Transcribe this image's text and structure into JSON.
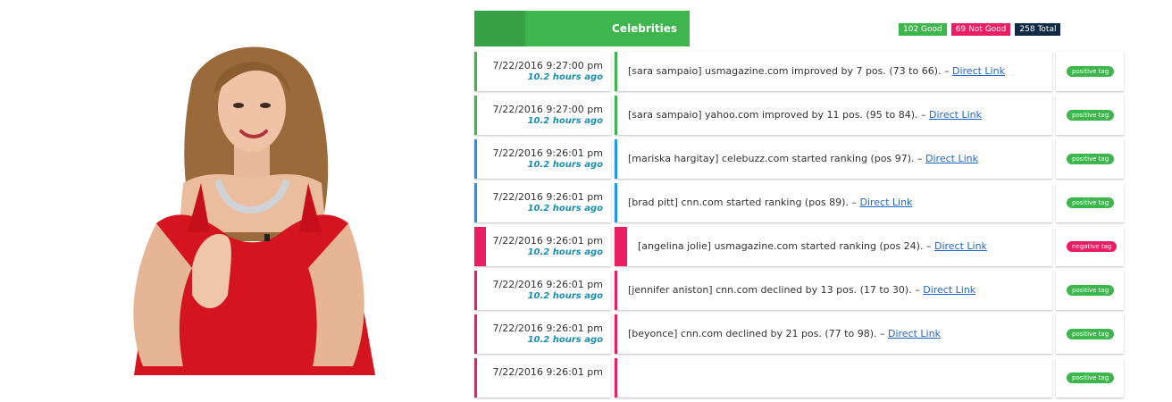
{
  "header": {
    "category": "Celebrities",
    "badges": {
      "good": "102 Good",
      "not_good": "69 Not Good",
      "total": "258 Total"
    },
    "colors": {
      "good": "#3fb54e",
      "not_good": "#e91e63",
      "total": "#102a43",
      "blue": "#2196f3"
    }
  },
  "rows": [
    {
      "time": "7/22/2016 9:27:00 pm",
      "ago": "10.2 hours ago",
      "message": "[sara sampaio] usmagazine.com improved by 7 pos. (73 to 66). –",
      "link": "Direct Link",
      "tag": "positive tag",
      "status": "green"
    },
    {
      "time": "7/22/2016 9:27:00 pm",
      "ago": "10.2 hours ago",
      "message": "[sara sampaio] yahoo.com improved by 11 pos. (95 to 84). –",
      "link": "Direct Link",
      "tag": "positive tag",
      "status": "green"
    },
    {
      "time": "7/22/2016 9:26:01 pm",
      "ago": "10.2 hours ago",
      "message": "[mariska hargitay] celebuzz.com started ranking (pos 97). –",
      "link": "Direct Link",
      "tag": "positive tag",
      "status": "blue"
    },
    {
      "time": "7/22/2016 9:26:01 pm",
      "ago": "10.2 hours ago",
      "message": "[brad pitt] cnn.com started ranking (pos 89). –",
      "link": "Direct Link",
      "tag": "positive tag",
      "status": "blue"
    },
    {
      "time": "7/22/2016 9:26:01 pm",
      "ago": "10.2 hours ago",
      "message": "[angelina jolie] usmagazine.com started ranking (pos 24). –",
      "link": "Direct Link",
      "tag": "negative tag",
      "status": "pink"
    },
    {
      "time": "7/22/2016 9:26:01 pm",
      "ago": "10.2 hours ago",
      "message": "[jennifer aniston] cnn.com declined by 13 pos. (17 to 30). –",
      "link": "Direct Link",
      "tag": "positive tag",
      "status": "pink"
    },
    {
      "time": "7/22/2016 9:26:01 pm",
      "ago": "10.2 hours ago",
      "message": "[beyonce] cnn.com declined by 21 pos. (77 to 98). –",
      "link": "Direct Link",
      "tag": "positive tag",
      "status": "pink"
    },
    {
      "time": "7/22/2016 9:26:01 pm",
      "ago": "",
      "message": "",
      "link": "",
      "tag": "positive tag",
      "status": "pink"
    }
  ]
}
